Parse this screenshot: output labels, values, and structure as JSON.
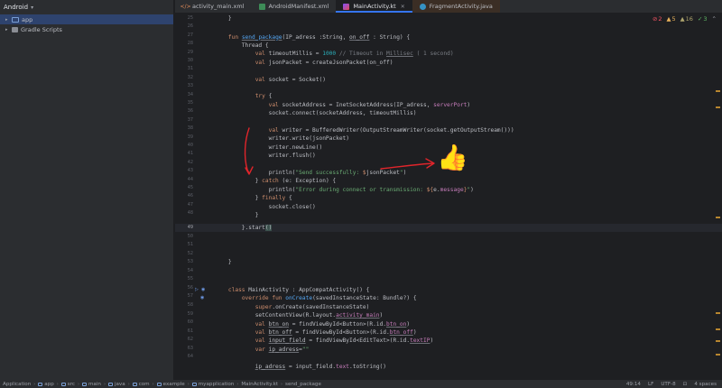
{
  "project": {
    "title": "Android",
    "items": [
      {
        "label": "app",
        "selected": true
      },
      {
        "label": "Gradle Scripts",
        "selected": false
      }
    ]
  },
  "tabs": [
    {
      "label": "activity_main.xml",
      "icon": "xml-file-icon"
    },
    {
      "label": "AndroidManifest.xml",
      "icon": "manifest-file-icon"
    },
    {
      "label": "MainActivity.kt",
      "icon": "kotlin-file-icon",
      "active": true
    },
    {
      "label": "FragmentActivity.java",
      "icon": "java-file-icon"
    }
  ],
  "inspections": {
    "errors": "2",
    "warnings": "5",
    "weak_warnings": "16",
    "ok": "3"
  },
  "editor": {
    "line_numbers": [
      "25",
      "26",
      "27",
      "28",
      "29",
      "30",
      "31",
      "32",
      "33",
      "34",
      "35",
      "36",
      "37",
      "38",
      "39",
      "40",
      "41",
      "42",
      "43",
      "44",
      "45",
      "46",
      "47",
      "48",
      "49",
      "50",
      "51",
      "52",
      "53",
      "54",
      "55",
      "56",
      "57",
      "58",
      "59",
      "60",
      "61",
      "62",
      "63",
      "64"
    ],
    "current_line": "49"
  },
  "annotations": {
    "thumb": "👍"
  },
  "status": {
    "breadcrumbs": [
      "Application",
      "app",
      "src",
      "main",
      "java",
      "com",
      "example",
      "myapplication",
      "MainActivity.kt",
      "send_package"
    ],
    "position": "49:14",
    "line_sep": "LF",
    "encoding": "UTF-8",
    "indent": "4 spaces"
  },
  "colors": {
    "accent": "#3574f0",
    "annotation": "#e0252b"
  }
}
